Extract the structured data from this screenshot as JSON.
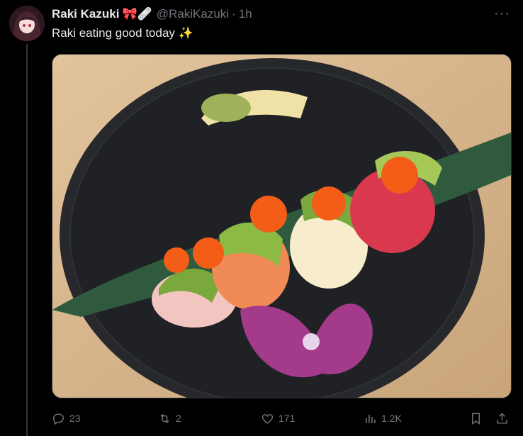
{
  "tweet": {
    "author_name": "Raki Kazuki",
    "author_emojis": "🎀🩹",
    "handle": "@RakiKazuki",
    "separator": "·",
    "time": "1h",
    "text": "Raki eating good today ✨",
    "more_label": "···"
  },
  "actions": {
    "replies": "23",
    "reposts": "2",
    "likes": "171",
    "views": "1.2K"
  },
  "icons": {
    "reply": "reply-icon",
    "repost": "repost-icon",
    "like": "like-icon",
    "views": "views-icon",
    "bookmark": "bookmark-icon",
    "share": "share-icon"
  }
}
